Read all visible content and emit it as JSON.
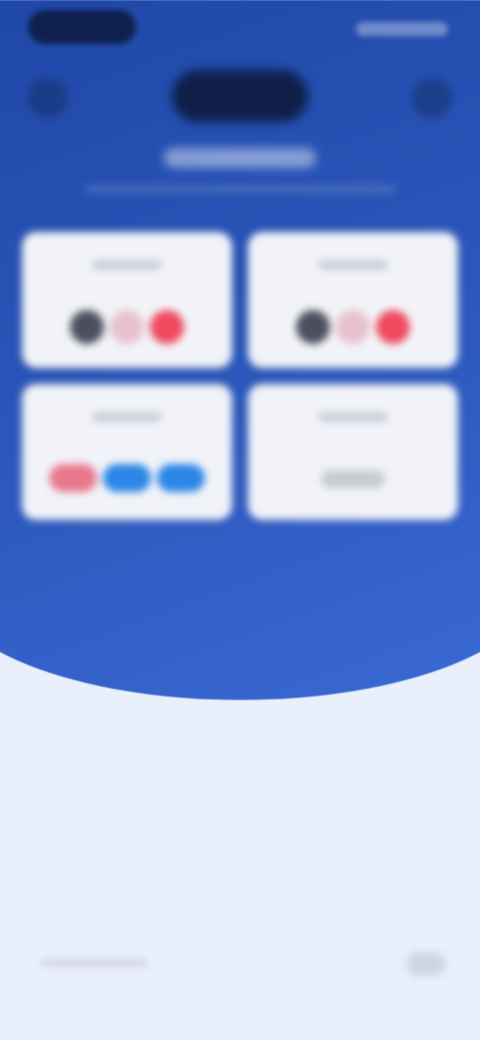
{
  "colors": {
    "hero_top": "#1f47a8",
    "hero_bottom": "#3a6ad6",
    "background": "#eaf0fb",
    "card": "#f1f3f8"
  },
  "icons": {
    "top_left": "menu-icon",
    "top_right": "profile-icon"
  },
  "cards": [
    {
      "chips": [
        "#4b4f5c",
        "#e7c2cc",
        "#ef4a5d"
      ]
    },
    {
      "chips": [
        "#4b4f5c",
        "#e7c2cc",
        "#ef4a5d"
      ]
    },
    {
      "chips": [
        "#e9788c",
        "#2b86e6",
        "#2b86e6"
      ]
    },
    {
      "chips": [
        "#c8cbd2"
      ]
    }
  ]
}
